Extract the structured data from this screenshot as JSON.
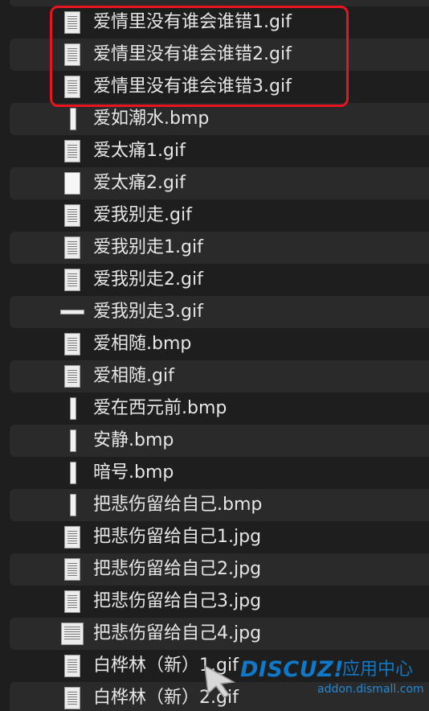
{
  "files": [
    {
      "name": "爱情里没有谁会谁错1.gif",
      "thumb": "page"
    },
    {
      "name": "爱情里没有谁会谁错2.gif",
      "thumb": "page"
    },
    {
      "name": "爱情里没有谁会谁错3.gif",
      "thumb": "page"
    },
    {
      "name": "爱如潮水.bmp",
      "thumb": "strip"
    },
    {
      "name": "爱太痛1.gif",
      "thumb": "page"
    },
    {
      "name": "爱太痛2.gif",
      "thumb": "blank"
    },
    {
      "name": "爱我别走.gif",
      "thumb": "page"
    },
    {
      "name": "爱我别走1.gif",
      "thumb": "page"
    },
    {
      "name": "爱我别走2.gif",
      "thumb": "page"
    },
    {
      "name": "爱我别走3.gif",
      "thumb": "wide"
    },
    {
      "name": "爱相随.bmp",
      "thumb": "page"
    },
    {
      "name": "爱相随.gif",
      "thumb": "page"
    },
    {
      "name": "爱在西元前.bmp",
      "thumb": "strip"
    },
    {
      "name": "安静.bmp",
      "thumb": "strip"
    },
    {
      "name": "暗号.bmp",
      "thumb": "strip"
    },
    {
      "name": "把悲伤留给自己.bmp",
      "thumb": "strip"
    },
    {
      "name": "把悲伤留给自己1.jpg",
      "thumb": "page"
    },
    {
      "name": "把悲伤留给自己2.jpg",
      "thumb": "page"
    },
    {
      "name": "把悲伤留给自己3.jpg",
      "thumb": "page"
    },
    {
      "name": "把悲伤留给自己4.jpg",
      "thumb": "wideish"
    },
    {
      "name": "白桦林（新）1.gif",
      "thumb": "page"
    },
    {
      "name": "白桦林（新）2.gif",
      "thumb": "page"
    }
  ],
  "watermark": {
    "brand": "DISCUZ!",
    "center": "应用中心",
    "url": "addon.dismall.com"
  },
  "colors": {
    "background": "#1e1e1e",
    "stripe": "#2a2a2a",
    "text": "#e6e6e6",
    "highlight": "#e8141f",
    "watermark": "#0f78c8"
  }
}
